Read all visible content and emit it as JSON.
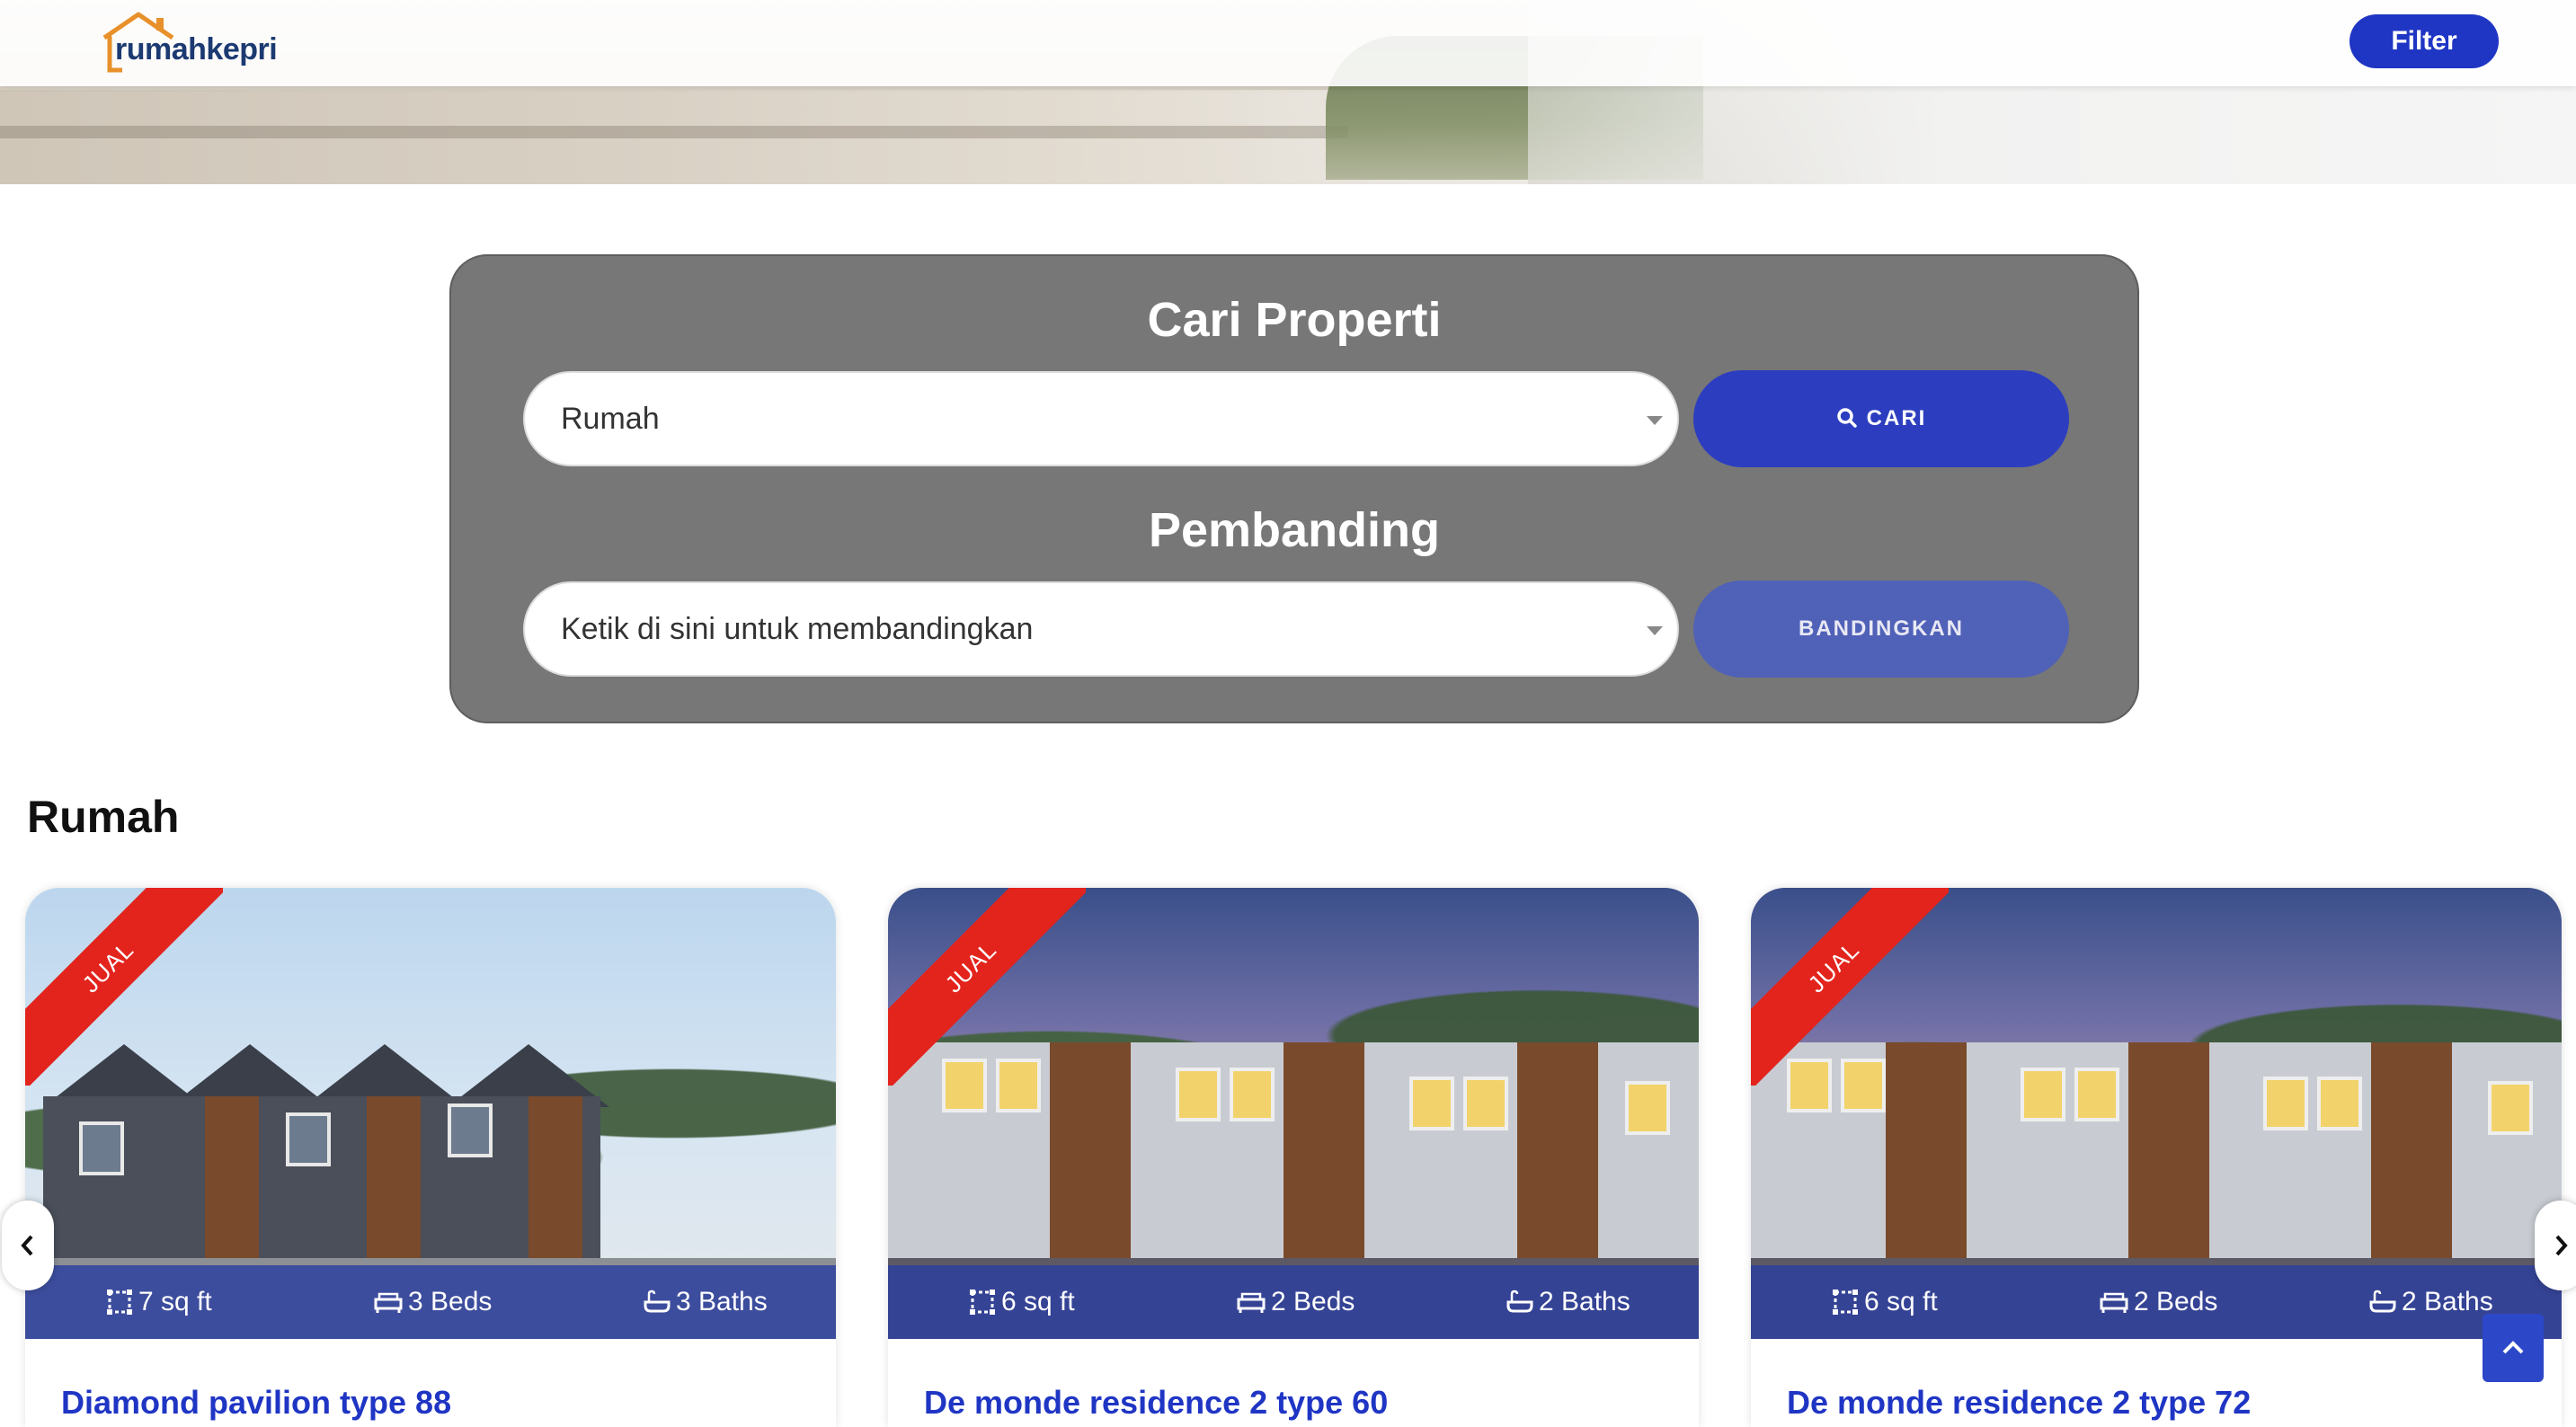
{
  "brand": {
    "logo_text": "rumahkepri"
  },
  "header": {
    "filter_label": "Filter"
  },
  "search": {
    "title": "Cari Properti",
    "selected_value": "Rumah",
    "button_label": "CARI"
  },
  "compare": {
    "title": "Pembanding",
    "placeholder": "Ketik di sini untuk membandingkan",
    "button_label": "BANDINGKAN"
  },
  "section": {
    "title": "Rumah"
  },
  "listings": [
    {
      "badge": "JUAL",
      "area": "7 sq ft",
      "beds": "3 Beds",
      "baths": "3 Baths",
      "title": "Diamond pavilion type 88"
    },
    {
      "badge": "JUAL",
      "area": "6 sq ft",
      "beds": "2 Beds",
      "baths": "2 Baths",
      "title": "De monde residence 2 type 60"
    },
    {
      "badge": "JUAL",
      "area": "6 sq ft",
      "beds": "2 Beds",
      "baths": "2 Baths",
      "title": "De monde residence 2 type 72"
    }
  ],
  "colors": {
    "primary": "#1f35c4",
    "panel": "#777777",
    "ribbon": "#e2241d",
    "logo": "#1c3a72",
    "logo_roof": "#e8902a"
  },
  "icons": {
    "area": "area-icon",
    "beds": "bed-icon",
    "baths": "bath-icon",
    "search": "search-icon",
    "prev": "chevron-left-icon",
    "next": "chevron-right-icon",
    "top": "chevron-up-icon"
  }
}
